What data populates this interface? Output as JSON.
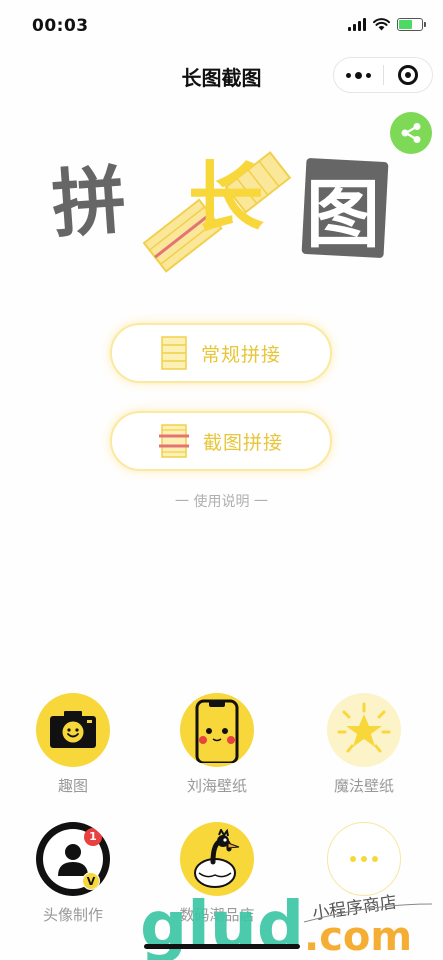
{
  "status_bar": {
    "time": "00:03",
    "battery_level": 0.6,
    "icons": [
      "signal-icon",
      "wifi-icon",
      "battery-charging-icon"
    ]
  },
  "nav": {
    "title": "长图截图",
    "more_icon": "more-dots-icon",
    "close_icon": "target-close-icon"
  },
  "share_icon": "share-icon",
  "logo": {
    "text_left": "拼",
    "text_middle": "长",
    "text_right": "图"
  },
  "actions": {
    "regular_label": "常规拼接",
    "screenshot_label": "截图拼接"
  },
  "usage_link": "一 使用说明 一",
  "grid": {
    "fun": "趣图",
    "notch": "刘海壁纸",
    "magic": "魔法壁纸",
    "avatar": "头像制作",
    "shop": "数码潮品店",
    "avatar_badge_count": "1",
    "avatar_v_badge": "V"
  },
  "watermark": {
    "brand": "glud",
    "domain": ".com",
    "tagline": "小程序商店"
  },
  "colors": {
    "accent_yellow": "#f8d73b",
    "share_green": "#7ed957",
    "label_gray": "#999999",
    "button_text": "#e7c63a",
    "watermark_green": "#3cc7a4",
    "watermark_orange": "#f5a623"
  }
}
